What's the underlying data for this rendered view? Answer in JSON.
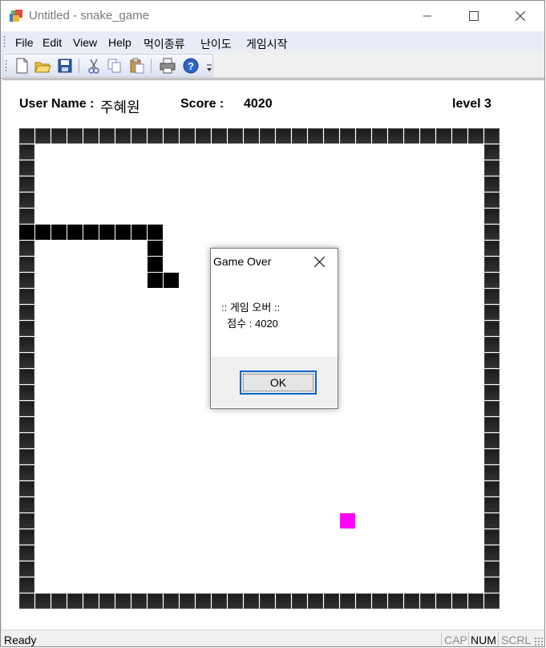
{
  "window": {
    "title": "Untitled - snake_game"
  },
  "menu": {
    "items": [
      "File",
      "Edit",
      "View",
      "Help",
      "먹이종류",
      "난이도",
      "게임시작"
    ]
  },
  "toolbar": {
    "buttons": [
      "new-file-icon",
      "open-folder-icon",
      "save-icon",
      "cut-icon",
      "copy-icon",
      "paste-icon",
      "print-icon",
      "help-icon"
    ]
  },
  "game": {
    "user_label": "User Name :",
    "user_name": "주혜원",
    "score_label": "Score :",
    "score_value": "4020",
    "level": "level 3",
    "food_color": "#ff00ff",
    "grid_size": 30,
    "snake_cells": [
      [
        0,
        6
      ],
      [
        1,
        6
      ],
      [
        2,
        6
      ],
      [
        3,
        6
      ],
      [
        4,
        6
      ],
      [
        5,
        6
      ],
      [
        6,
        6
      ],
      [
        7,
        6
      ],
      [
        8,
        6
      ],
      [
        8,
        7
      ],
      [
        8,
        8
      ],
      [
        8,
        9
      ],
      [
        9,
        9
      ]
    ],
    "food_cell": [
      20,
      24
    ]
  },
  "dialog": {
    "title": "Game Over",
    "line1": ":: 게임 오버 ::",
    "line2": "점수 : 4020",
    "ok_label": "OK"
  },
  "status": {
    "text": "Ready",
    "cap": "CAP",
    "num": "NUM",
    "scrl": "SCRL"
  }
}
